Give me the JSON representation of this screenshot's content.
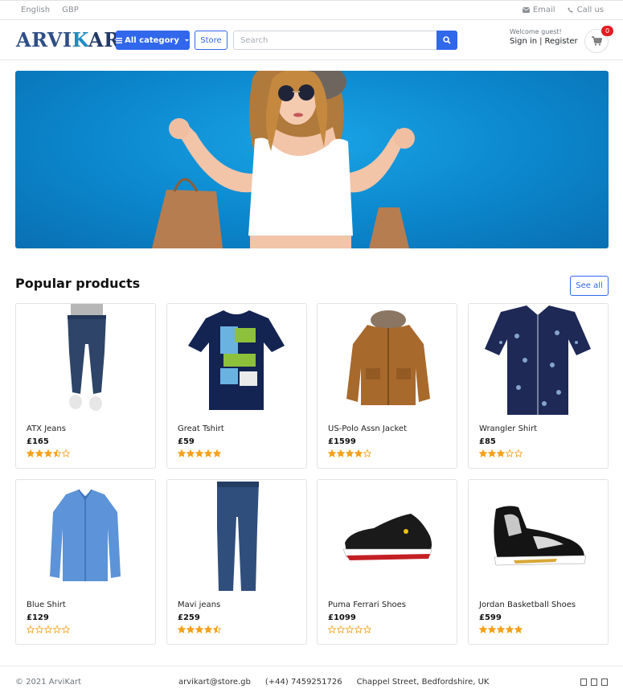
{
  "topbar": {
    "language": "English",
    "currency": "GBP",
    "email_label": "Email",
    "call_label": "Call us"
  },
  "header": {
    "logo": {
      "part1": "ARVI",
      "part2": "K",
      "part3": "ART"
    },
    "category_button": "All category",
    "store_button": "Store",
    "search_placeholder": "Search",
    "welcome": "Welcome guest!",
    "sign_in": "Sign in",
    "separator": "|",
    "register": "Register",
    "cart_count": "0"
  },
  "section": {
    "title": "Popular products",
    "see_all": "See all"
  },
  "products": [
    {
      "name": "ATX Jeans",
      "price": "£165",
      "rating": 3.5
    },
    {
      "name": "Great Tshirt",
      "price": "£59",
      "rating": 5
    },
    {
      "name": "US-Polo Assn Jacket",
      "price": "£1599",
      "rating": 4
    },
    {
      "name": "Wrangler Shirt",
      "price": "£85",
      "rating": 3
    },
    {
      "name": "Blue Shirt",
      "price": "£129",
      "rating": 0
    },
    {
      "name": "Mavi jeans",
      "price": "£259",
      "rating": 4.5
    },
    {
      "name": "Puma Ferrari Shoes",
      "price": "£1099",
      "rating": 0
    },
    {
      "name": "Jordan Basketball Shoes",
      "price": "£599",
      "rating": 5
    }
  ],
  "footer": {
    "copyright": "© 2021 ArviKart",
    "email": "arvikart@store.gb",
    "phone": "(+44) 7459251726",
    "address": "Chappel Street, Bedfordshire, UK"
  },
  "colors": {
    "primary": "#3167eb",
    "star": "#f6a11a",
    "badge": "#e31b23"
  }
}
